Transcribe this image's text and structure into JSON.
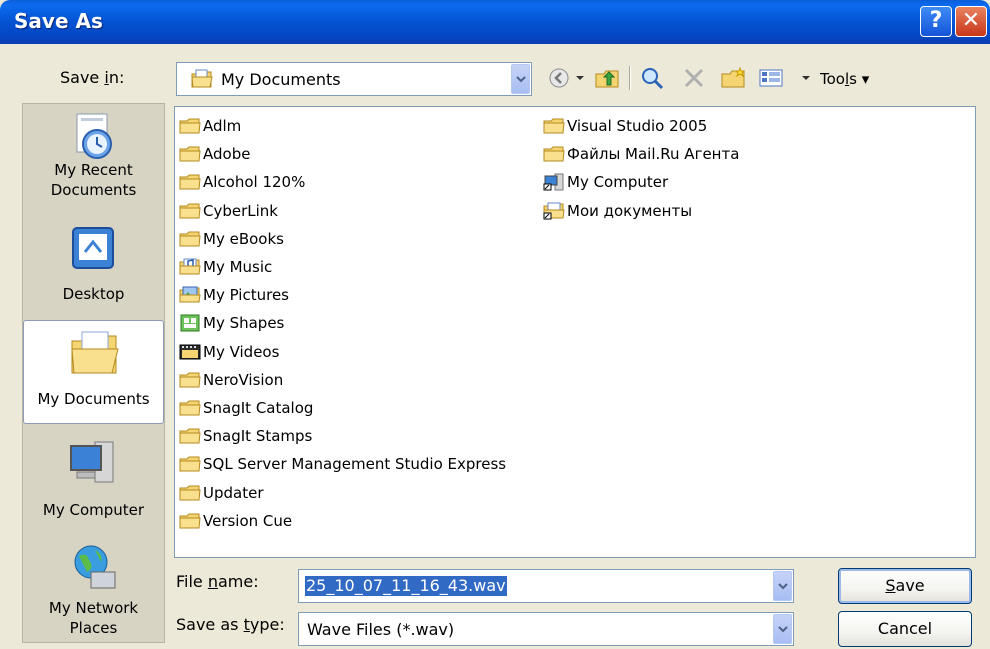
{
  "window": {
    "title": "Save As",
    "help_glyph": "?",
    "close_glyph": "✕"
  },
  "save_in": {
    "label_prefix": "Save ",
    "label_accel": "i",
    "label_suffix": "n:",
    "value": "My Documents",
    "icon": "my-documents-icon"
  },
  "toolbar": {
    "items": [
      "back-icon",
      "dropdown-arrow-icon",
      "up-folder-icon",
      "search-web-icon",
      "delete-icon",
      "new-folder-icon",
      "views-icon"
    ],
    "tools_prefix": "Too",
    "tools_accel": "l",
    "tools_suffix": "s"
  },
  "places": [
    {
      "label_line1": "My Recent",
      "label_line2": "Documents",
      "icon": "recent-documents-icon"
    },
    {
      "label_line1": "Desktop",
      "label_line2": "",
      "icon": "desktop-icon"
    },
    {
      "label_line1": "My Documents",
      "label_line2": "",
      "icon": "my-documents-folder-icon",
      "selected": true
    },
    {
      "label_line1": "My Computer",
      "label_line2": "",
      "icon": "my-computer-icon"
    },
    {
      "label_line1": "My Network",
      "label_line2": "Places",
      "icon": "network-places-icon"
    }
  ],
  "files_col1": [
    {
      "name": "Adlm",
      "icon": "folder-icon"
    },
    {
      "name": "Adobe",
      "icon": "folder-icon"
    },
    {
      "name": "Alcohol 120%",
      "icon": "folder-icon"
    },
    {
      "name": "CyberLink",
      "icon": "folder-icon"
    },
    {
      "name": "My eBooks",
      "icon": "folder-icon"
    },
    {
      "name": "My Music",
      "icon": "music-folder-icon"
    },
    {
      "name": "My Pictures",
      "icon": "pictures-folder-icon"
    },
    {
      "name": "My Shapes",
      "icon": "shapes-folder-icon"
    },
    {
      "name": "My Videos",
      "icon": "videos-folder-icon"
    },
    {
      "name": "NeroVision",
      "icon": "folder-icon"
    },
    {
      "name": "SnagIt Catalog",
      "icon": "folder-icon"
    },
    {
      "name": "SnagIt Stamps",
      "icon": "folder-icon"
    },
    {
      "name": "SQL Server Management Studio Express",
      "icon": "folder-icon"
    },
    {
      "name": "Updater",
      "icon": "folder-icon"
    },
    {
      "name": "Version Cue",
      "icon": "folder-icon"
    }
  ],
  "files_col2": [
    {
      "name": "Visual Studio 2005",
      "icon": "folder-icon"
    },
    {
      "name": "Файлы Mail.Ru Агента",
      "icon": "folder-icon"
    },
    {
      "name": "My Computer",
      "icon": "computer-shortcut-icon"
    },
    {
      "name": "Мои документы",
      "icon": "documents-shortcut-icon"
    }
  ],
  "file_name": {
    "label_prefix": "File ",
    "label_accel": "n",
    "label_suffix": "ame:",
    "value": "25_10_07_11_16_43.wav"
  },
  "save_as_type": {
    "label_prefix": "Save as ",
    "label_accel": "t",
    "label_suffix": "ype:",
    "value": "Wave Files (*.wav)"
  },
  "buttons": {
    "save_accel": "S",
    "save_rest": "ave",
    "cancel": "Cancel"
  }
}
